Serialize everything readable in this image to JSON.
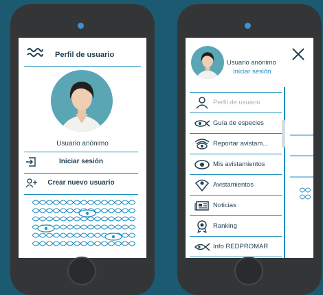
{
  "left_screen": {
    "header_title": "Perfil de usuario",
    "user_name": "Usuario anónimo",
    "actions": [
      {
        "label": "Iniciar sesión",
        "icon": "login-icon"
      },
      {
        "label": "Crear nuevo usuario",
        "icon": "add-user-icon"
      }
    ]
  },
  "right_screen": {
    "user_name": "Usuario anónimo",
    "login_link": "Iniciar sesión",
    "menu": [
      {
        "label": "Perfil de usuario",
        "icon": "person-icon"
      },
      {
        "label": "Guía de especies",
        "icon": "fish-eye-icon"
      },
      {
        "label": "Reportar avistam...",
        "icon": "eye-waves-icon"
      },
      {
        "label": "Mis avistamientos",
        "icon": "eye-icon"
      },
      {
        "label": "Avistamientos",
        "icon": "eye-pin-icon"
      },
      {
        "label": "Noticias",
        "icon": "newspaper-icon"
      },
      {
        "label": "Ranking",
        "icon": "medal-icon"
      },
      {
        "label": "Info REDPROMAR",
        "icon": "fish-logo-icon"
      }
    ]
  },
  "colors": {
    "background": "#1c5a72",
    "accent": "#1b8dbf",
    "text_dark": "#1f3f52",
    "avatar_bg": "#5aa6b5"
  }
}
